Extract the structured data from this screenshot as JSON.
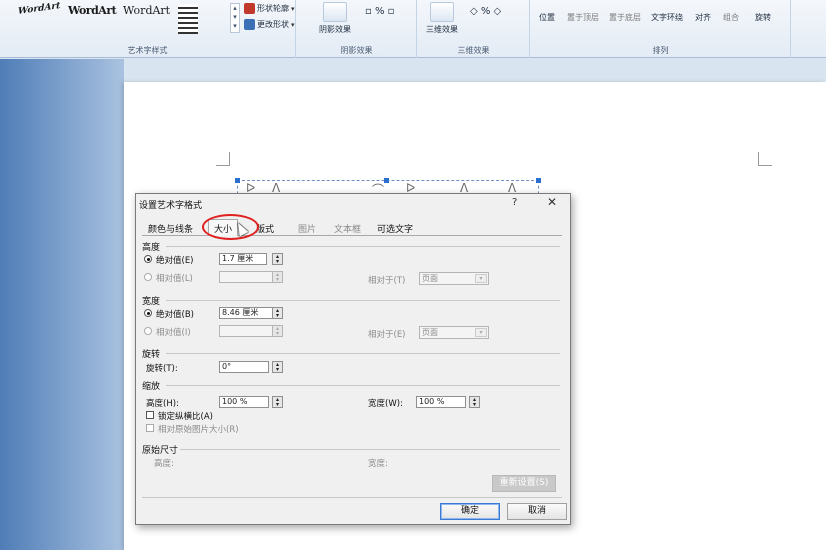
{
  "ribbon": {
    "wordart_styles": [
      "WordArt",
      "WordArt",
      "WordArt"
    ],
    "shape_outline": "形状轮廓",
    "change_shape": "更改形状",
    "shadow_effect": "阴影效果",
    "three_d_effect": "三维效果",
    "position": "位置",
    "bring_to_front": "置于顶层",
    "send_to_back": "置于底层",
    "text_wrap": "文字环绕",
    "align": "对齐",
    "group": "组合",
    "rotate": "旋转",
    "groups": {
      "wordart_styles": "艺术字样式",
      "shadow_effects": "阴影效果",
      "three_d_effects": "三维效果",
      "arrange": "排列"
    }
  },
  "dialog": {
    "title": "设置艺术字格式",
    "help": "?",
    "close": "✕",
    "tabs": [
      "颜色与线条",
      "大小",
      "版式",
      "图片",
      "文本框",
      "可选文字"
    ],
    "height": {
      "header": "高度",
      "absolute_label": "绝对值(E)",
      "absolute_value": "1.7 厘米",
      "relative_label": "相对值(L)",
      "relative_to_label": "相对于(T)",
      "relative_to_value": "页面"
    },
    "width": {
      "header": "宽度",
      "absolute_label": "绝对值(B)",
      "absolute_value": "8.46 厘米",
      "relative_label": "相对值(I)",
      "relative_to_label": "相对于(E)",
      "relative_to_value": "页面"
    },
    "rotate": {
      "header": "旋转",
      "label": "旋转(T):",
      "value": "0°"
    },
    "scale": {
      "header": "缩放",
      "height_label": "高度(H):",
      "height_value": "100 %",
      "width_label": "宽度(W):",
      "width_value": "100 %",
      "lock_aspect": "锁定纵横比(A)",
      "relative_original": "相对原始图片大小(R)"
    },
    "original": {
      "header": "原始尺寸",
      "height_label": "高度:",
      "width_label": "宽度:"
    },
    "reset_button": "重新设置(S)",
    "ok_button": "确定",
    "cancel_button": "取消"
  },
  "colors": {
    "highlight": "#e0201f",
    "default_button_border": "#3a7bd5"
  }
}
